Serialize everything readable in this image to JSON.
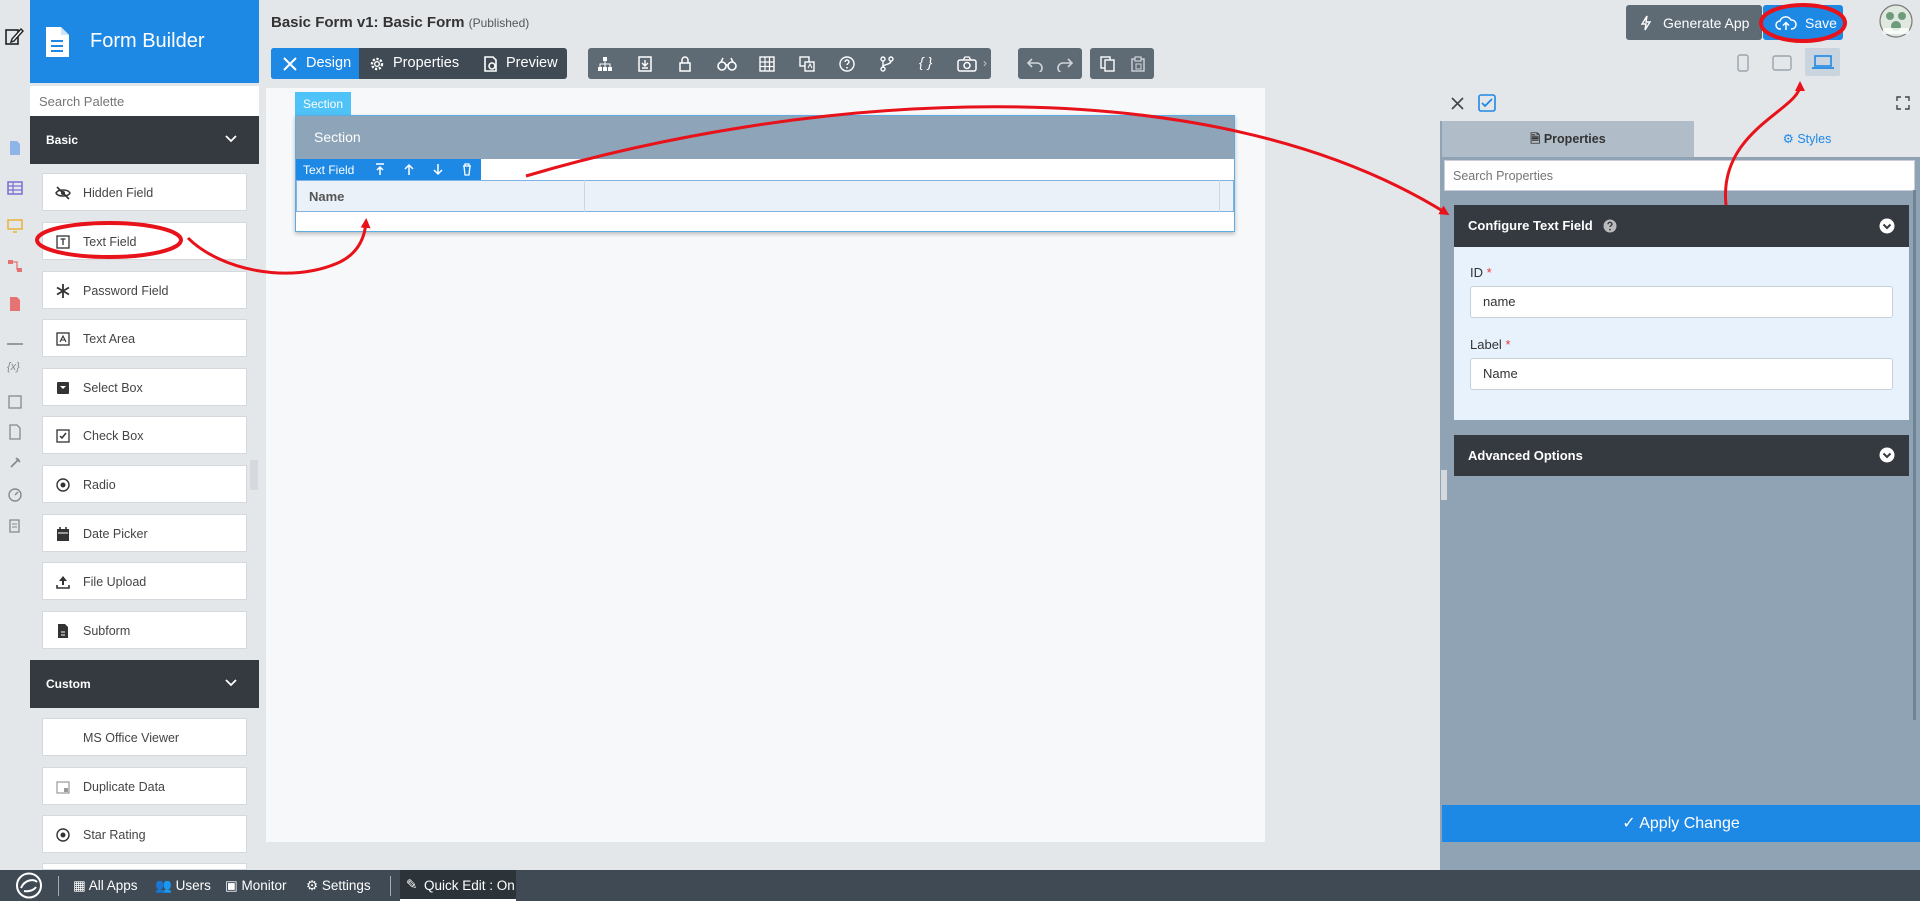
{
  "header": {
    "app_title": "Form Builder",
    "form_title": "Basic Form v1: Basic Form",
    "form_status": "(Published)",
    "generate_app": "Generate App",
    "save": "Save"
  },
  "toolbar": {
    "tabs": [
      {
        "label": "Design",
        "icon": "design-icon",
        "active": true
      },
      {
        "label": "Properties",
        "icon": "gear-icon",
        "active": false
      },
      {
        "label": "Preview",
        "icon": "preview-icon",
        "active": false
      }
    ],
    "tools": [
      "sitemap-icon",
      "import-icon",
      "lock-icon",
      "binoculars-icon",
      "table-icon",
      "translate-icon",
      "help-icon",
      "branch-icon",
      "braces-icon",
      "camera-icon"
    ],
    "history": [
      "undo-icon",
      "redo-icon"
    ],
    "clipboard": [
      "copy-icon",
      "paste-icon"
    ],
    "devices": [
      "phone-icon",
      "tablet-icon",
      "laptop-icon"
    ]
  },
  "palette": {
    "search_placeholder": "Search Palette",
    "basic_group": "Basic",
    "basic_items": [
      "Hidden Field",
      "Text Field",
      "Password Field",
      "Text Area",
      "Select Box",
      "Check Box",
      "Radio",
      "Date Picker",
      "File Upload",
      "Subform"
    ],
    "custom_group": "Custom",
    "custom_items": [
      "MS Office Viewer",
      "Duplicate Data",
      "Star Rating"
    ]
  },
  "canvas": {
    "section_tag": "Section",
    "section_title": "Section",
    "field_bar_label": "Text Field",
    "field_label": "Name"
  },
  "properties_panel": {
    "tab_properties": "Properties",
    "tab_styles": "Styles",
    "search_placeholder": "Search Properties",
    "configure_title": "Configure Text Field",
    "id_label": "ID",
    "id_value": "name",
    "label_label": "Label",
    "label_value": "Name",
    "advanced_options": "Advanced Options",
    "apply_change": "Apply Change"
  },
  "bottom_bar": {
    "all_apps": "All Apps",
    "users": "Users",
    "monitor": "Monitor",
    "settings": "Settings",
    "quick_edit": "Quick Edit : On"
  },
  "colors": {
    "accent": "#1e88e5",
    "dark": "#343a40",
    "annotation": "#e8121a"
  }
}
